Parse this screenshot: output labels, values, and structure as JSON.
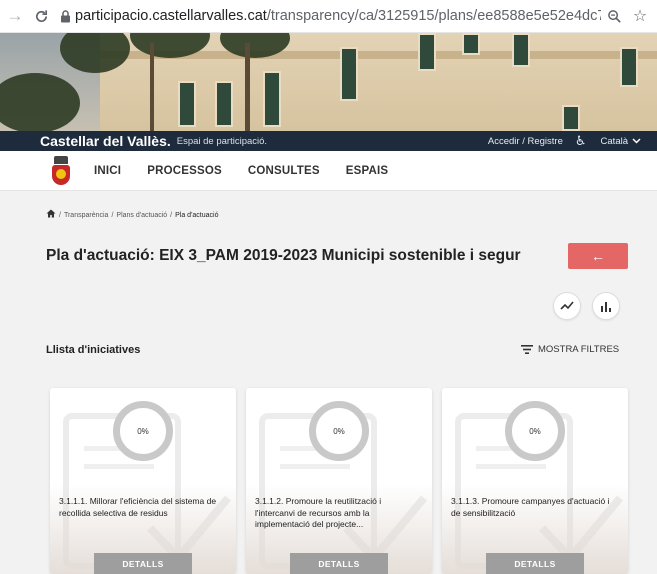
{
  "browser": {
    "url_host": "participacio.castellarvalles.cat",
    "url_path": "/transparency/ca/3125915/plans/ee8588e5e52e4dc7bcbfd..."
  },
  "site": {
    "title": "Castellar del Vallès.",
    "subtitle": "Espai de participació.",
    "login": "Accedir / Registre",
    "language": "Català"
  },
  "nav": {
    "items": [
      "INICI",
      "PROCESSOS",
      "CONSULTES",
      "ESPAIS"
    ]
  },
  "breadcrumb": [
    "Transparència",
    "Plans d'actuació",
    "Pla d'actuació"
  ],
  "page": {
    "title": "Pla d'actuació: EIX 3_PAM 2019-2023 Municipi sostenible i segur",
    "back_icon": "arrow-left-icon"
  },
  "list": {
    "title": "Llista d'iniciatives",
    "filters_label": "MOSTRA FILTRES"
  },
  "cards": [
    {
      "progress": "0%",
      "text": "3.1.1.1. Millorar l'eficiència del sistema de recollida selectiva de residus",
      "button": "DETALLS"
    },
    {
      "progress": "0%",
      "text": "3.1.1.2. Promoure la reutilització i l'intercanvi de recursos amb la implementació del projecte...",
      "button": "DETALLS"
    },
    {
      "progress": "0%",
      "text": "3.1.1.3. Promoure campanyes d'actuació i de sensibilització",
      "button": "DETALLS"
    }
  ],
  "colors": {
    "site_bar": "#1d2b3c",
    "back_button": "#e46766",
    "details_button": "#9e9e9e"
  }
}
